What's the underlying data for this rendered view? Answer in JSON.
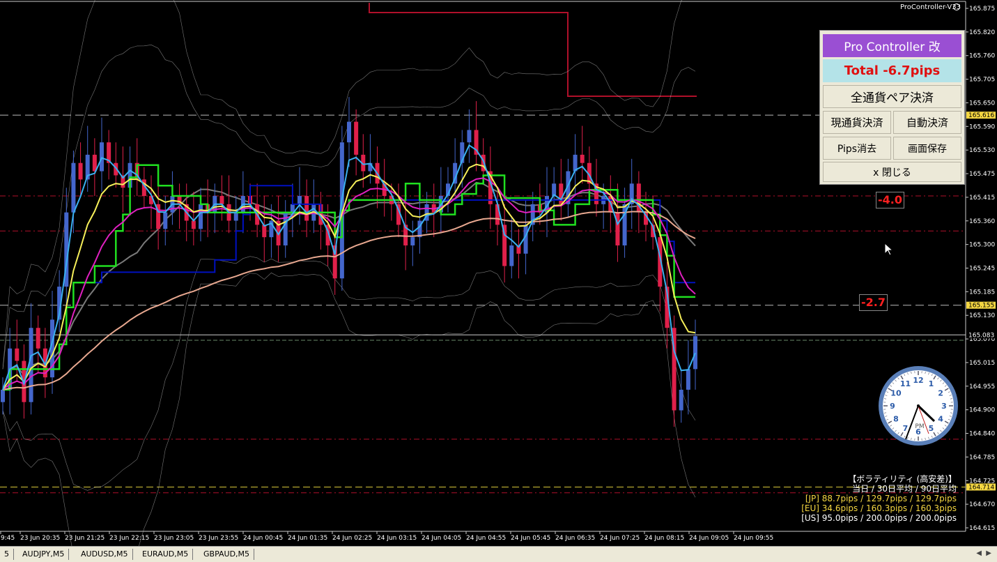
{
  "window": {
    "ea_name": "ProController-V33"
  },
  "panel": {
    "title": "Pro Controller 改",
    "total": "Total   -6.7pips",
    "close_all": "全通貨ペア決済",
    "close_current": "現通貨決済",
    "auto_close": "自動決済",
    "clear_pips": "Pips消去",
    "save_screen": "画面保存",
    "close_panel": "x 閉じる"
  },
  "pips_labels": {
    "upper": "-4.0",
    "lower": "-2.7"
  },
  "price_axis": {
    "ticks": [
      "165.875",
      "165.820",
      "165.760",
      "165.705",
      "165.650",
      "165.590",
      "165.530",
      "165.475",
      "165.415",
      "165.360",
      "165.300",
      "165.245",
      "165.185",
      "165.130",
      "165.070",
      "165.015",
      "164.955",
      "164.900",
      "164.840",
      "164.785",
      "164.725",
      "164.670",
      "164.615"
    ],
    "highlight_prices": [
      {
        "label": "165.616",
        "bg": "#f5d742",
        "fg": "#000"
      },
      {
        "label": "165.155",
        "bg": "#f5d742",
        "fg": "#000"
      },
      {
        "label": "165.083",
        "bg": "#000",
        "fg": "#fff"
      },
      {
        "label": "164.714",
        "bg": "#f5d742",
        "fg": "#000"
      }
    ]
  },
  "time_axis": {
    "ticks": [
      "9:45",
      "23 Jun 20:35",
      "23 Jun 21:25",
      "23 Jun 22:15",
      "23 Jun 23:05",
      "23 Jun 23:55",
      "24 Jun 00:45",
      "24 Jun 01:35",
      "24 Jun 02:25",
      "24 Jun 03:15",
      "24 Jun 04:05",
      "24 Jun 04:55",
      "24 Jun 05:45",
      "24 Jun 06:35",
      "24 Jun 07:25",
      "24 Jun 08:15",
      "24 Jun 09:05",
      "24 Jun 09:55"
    ]
  },
  "volatility": {
    "title": "【ボラティリティ (高安差)】",
    "header": "当日 / 30日平均 / 90日平均",
    "jp": "[JP] 88.7pips / 129.7pips / 129.7pips",
    "eu": "[EU] 34.6pips / 160.3pips / 160.3pips",
    "us": "[US] 95.0pips / 200.0pips / 200.0pips"
  },
  "tabs": [
    "5",
    "AUDJPY,M5",
    "AUDUSD,M5",
    "EURAUD,M5",
    "GBPAUD,M5"
  ],
  "clock": {
    "label": "PM",
    "numbers": [
      "12",
      "1",
      "2",
      "3",
      "4",
      "5",
      "6",
      "7",
      "8",
      "9",
      "10",
      "11"
    ]
  },
  "colors": {
    "bull": "#4466cc",
    "bear": "#e0204a",
    "ema_fast": "#3ab0f0",
    "ema_slow": "#f7f05a",
    "ema_mag": "#e020c0",
    "ema_tan": "#e8a890",
    "step_green": "#20e020",
    "step_blue": "#0010c0",
    "gray_line": "#7a7a7a",
    "band": "#c8c8c8",
    "resistance": "#b0102a"
  },
  "chart_data": {
    "type": "candlestick",
    "symbol_timeframe": "M5",
    "y_range": [
      164.615,
      165.875
    ],
    "closes": [
      164.95,
      165.05,
      165.02,
      164.92,
      165.1,
      165.05,
      164.98,
      165.12,
      165.2,
      165.38,
      165.5,
      165.46,
      165.52,
      165.48,
      165.55,
      165.5,
      165.47,
      165.44,
      165.5,
      165.46,
      165.42,
      165.4,
      165.34,
      165.38,
      165.42,
      165.4,
      165.36,
      165.34,
      165.4,
      165.38,
      165.42,
      165.4,
      165.36,
      165.38,
      165.42,
      165.4,
      165.35,
      165.32,
      165.36,
      165.3,
      165.38,
      165.4,
      165.42,
      165.36,
      165.4,
      165.35,
      165.3,
      165.22,
      165.55,
      165.6,
      165.52,
      165.48,
      165.5,
      165.45,
      165.42,
      165.4,
      165.35,
      165.3,
      165.32,
      165.36,
      165.4,
      165.38,
      165.42,
      165.45,
      165.5,
      165.55,
      165.58,
      165.52,
      165.48,
      165.4,
      165.35,
      165.25,
      165.3,
      165.28,
      165.35,
      165.4,
      165.38,
      165.42,
      165.45,
      165.4,
      165.48,
      165.52,
      165.5,
      165.45,
      165.4,
      165.42,
      165.38,
      165.3,
      165.4,
      165.45,
      165.38,
      165.35,
      165.32,
      165.2,
      165.1,
      164.9,
      164.95,
      165.0,
      165.08
    ]
  }
}
